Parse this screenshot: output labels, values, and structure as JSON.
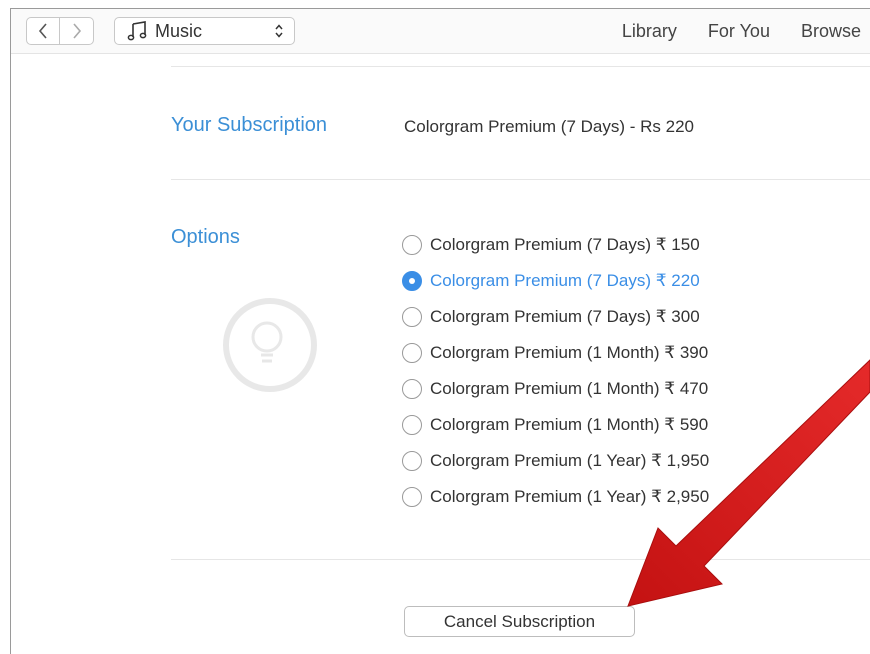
{
  "toolbar": {
    "back_icon": "chevron-left-icon",
    "forward_icon": "chevron-right-icon",
    "media_icon": "music-note-icon",
    "media_label": "Music",
    "nav": [
      "Library",
      "For You",
      "Browse"
    ]
  },
  "subscription": {
    "label": "Your Subscription",
    "value": "Colorgram Premium (7 Days) - Rs 220"
  },
  "options": {
    "label": "Options",
    "items": [
      {
        "text": "Colorgram Premium (7 Days) ₹ 150",
        "selected": false
      },
      {
        "text": "Colorgram Premium (7 Days) ₹ 220",
        "selected": true
      },
      {
        "text": "Colorgram Premium (7 Days) ₹ 300",
        "selected": false
      },
      {
        "text": "Colorgram Premium (1 Month) ₹ 390",
        "selected": false
      },
      {
        "text": "Colorgram Premium (1 Month) ₹ 470",
        "selected": false
      },
      {
        "text": "Colorgram Premium (1 Month) ₹ 590",
        "selected": false
      },
      {
        "text": "Colorgram Premium (1 Year) ₹ 1,950",
        "selected": false
      },
      {
        "text": "Colorgram Premium (1 Year) ₹ 2,950",
        "selected": false
      }
    ]
  },
  "cancel_label": "Cancel Subscription",
  "colors": {
    "accent": "#3a8ee6",
    "arrow": "#e01b1b"
  }
}
